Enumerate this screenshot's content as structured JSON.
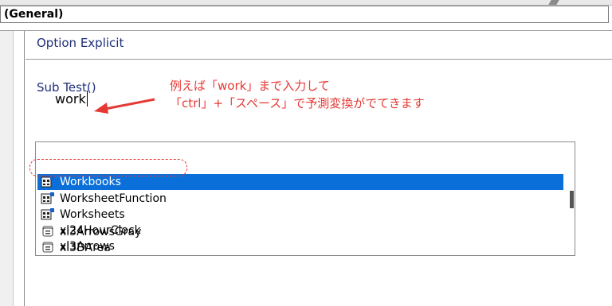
{
  "object_combo": {
    "value": "(General)"
  },
  "code": {
    "line1": "Option Explicit",
    "line2": "Sub Test()",
    "typed": "work"
  },
  "annotation": {
    "line1": "例えば「work」まで入力して",
    "line2": "「ctrl」+「スペース」で予測変換がでてきます",
    "color": "#e53935"
  },
  "autocomplete": {
    "items": [
      {
        "label": "Workbooks",
        "icon": "property-icon",
        "selected": true
      },
      {
        "label": "WorksheetFunction",
        "icon": "property-icon",
        "selected": false
      },
      {
        "label": "Worksheets",
        "icon": "property-icon",
        "selected": false
      },
      {
        "label": "xl24HourClock",
        "icon": "constant-icon",
        "selected": false
      },
      {
        "label": "xl3Arrows",
        "icon": "constant-icon",
        "selected": false
      },
      {
        "label": "xl3ArrowsGray",
        "icon": "constant-icon",
        "selected": false
      },
      {
        "label": "xl3DArea",
        "icon": "constant-icon",
        "selected": false
      }
    ],
    "selected_color": "#0a6fd8"
  }
}
